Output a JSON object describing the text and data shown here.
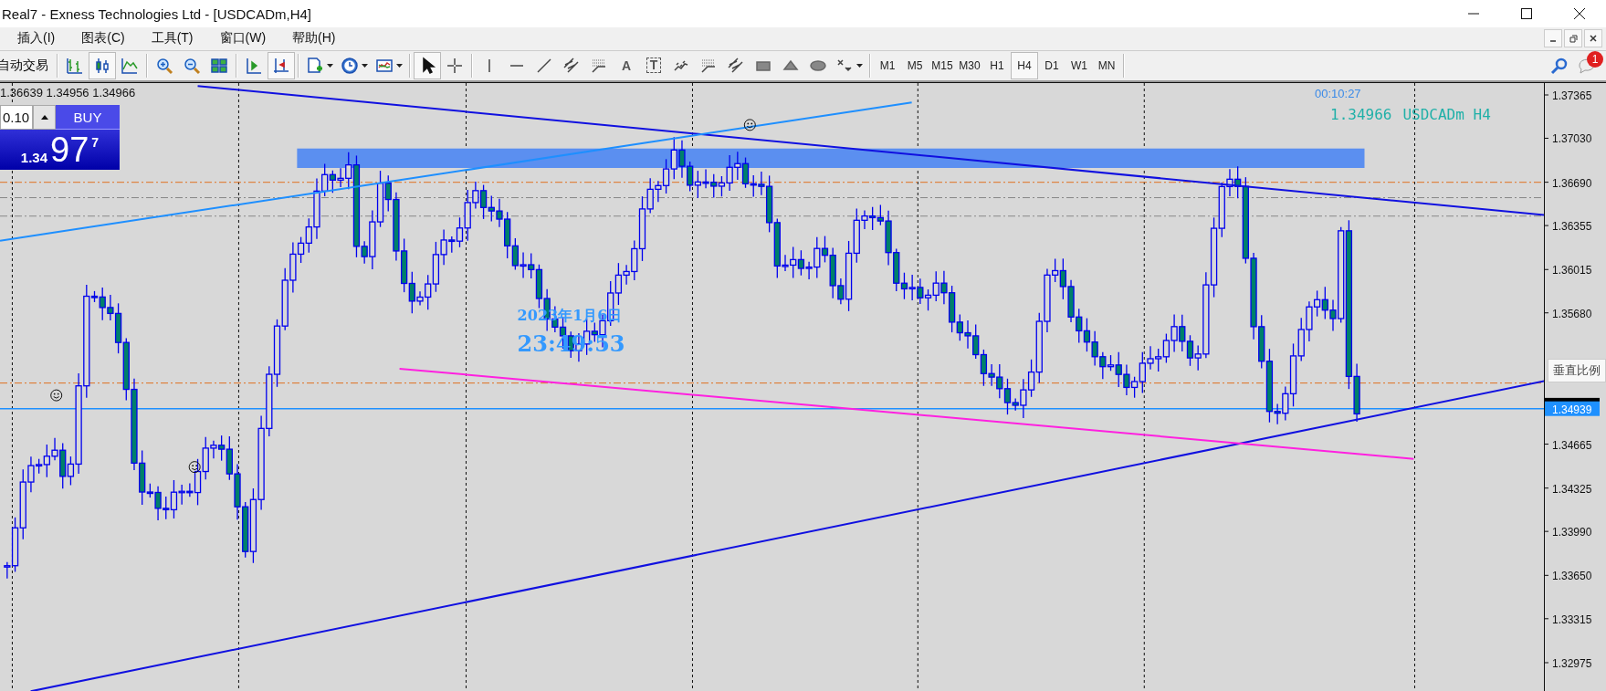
{
  "window": {
    "title": "Real7 - Exness Technologies Ltd - [USDCADm,H4]"
  },
  "menu": [
    {
      "label": "插入(I)"
    },
    {
      "label": "图表(C)"
    },
    {
      "label": "工具(T)"
    },
    {
      "label": "窗口(W)"
    },
    {
      "label": "帮助(H)"
    }
  ],
  "toolbar": {
    "autotrade_label": "自动交易",
    "groups": [
      [
        {
          "kind": "bars",
          "pressed": false
        },
        {
          "kind": "candles",
          "pressed": true
        },
        {
          "kind": "line",
          "pressed": false
        }
      ],
      [
        {
          "kind": "zoomin",
          "pressed": false
        },
        {
          "kind": "zoomout",
          "pressed": false
        },
        {
          "kind": "tile",
          "pressed": false
        }
      ],
      [
        {
          "kind": "autoscroll",
          "pressed": false
        },
        {
          "kind": "shift",
          "pressed": true
        }
      ],
      [
        {
          "kind": "neworder",
          "pressed": false,
          "dropdown": true
        },
        {
          "kind": "clock",
          "pressed": false,
          "dropdown": true
        },
        {
          "kind": "indicators",
          "pressed": false,
          "dropdown": true
        }
      ],
      [
        {
          "kind": "cursor",
          "pressed": true
        },
        {
          "kind": "crosshair",
          "pressed": false
        }
      ],
      [
        {
          "kind": "vline",
          "pressed": false
        },
        {
          "kind": "hline",
          "pressed": false
        },
        {
          "kind": "trend",
          "pressed": false
        },
        {
          "kind": "channel",
          "pressed": false
        },
        {
          "kind": "fibo",
          "pressed": false
        },
        {
          "kind": "text",
          "label": "A",
          "pressed": false
        },
        {
          "kind": "label",
          "label": "T",
          "pressed": false
        },
        {
          "kind": "pitchfork",
          "pressed": false
        },
        {
          "kind": "fibo",
          "pressed": false
        },
        {
          "kind": "channel",
          "pressed": false
        },
        {
          "kind": "rect",
          "pressed": false
        },
        {
          "kind": "triangle",
          "pressed": false
        },
        {
          "kind": "ellipse",
          "pressed": false
        },
        {
          "kind": "arrows",
          "pressed": false,
          "dropdown": true
        }
      ]
    ],
    "timeframes": [
      {
        "label": "M1",
        "selected": false
      },
      {
        "label": "M5",
        "selected": false
      },
      {
        "label": "M15",
        "selected": false
      },
      {
        "label": "M30",
        "selected": false
      },
      {
        "label": "H1",
        "selected": false
      },
      {
        "label": "H4",
        "selected": true
      },
      {
        "label": "D1",
        "selected": false
      },
      {
        "label": "W1",
        "selected": false
      },
      {
        "label": "MN",
        "selected": false
      }
    ],
    "notification_count": "1"
  },
  "chart": {
    "ohlc": "1.36639 1.34956 1.34966",
    "trade_panel": {
      "lot": "0.10",
      "button": "BUY",
      "price_prefix": "1.34",
      "price_big": "97",
      "price_sup": "7"
    },
    "timer": "00:10:27",
    "quote": "1.34966",
    "symbol": "USDCADm H4",
    "datetime_date": "2023年1月6日",
    "datetime_time": "23:49:53",
    "price_axis": [
      "1.37365",
      "1.37030",
      "1.36690",
      "1.36355",
      "1.36015",
      "1.35680",
      "1.34665",
      "1.34325",
      "1.33990",
      "1.33650",
      "1.33315",
      "1.32975"
    ],
    "current_price_label": "1.34939",
    "tooltip": "垂直比例"
  }
}
